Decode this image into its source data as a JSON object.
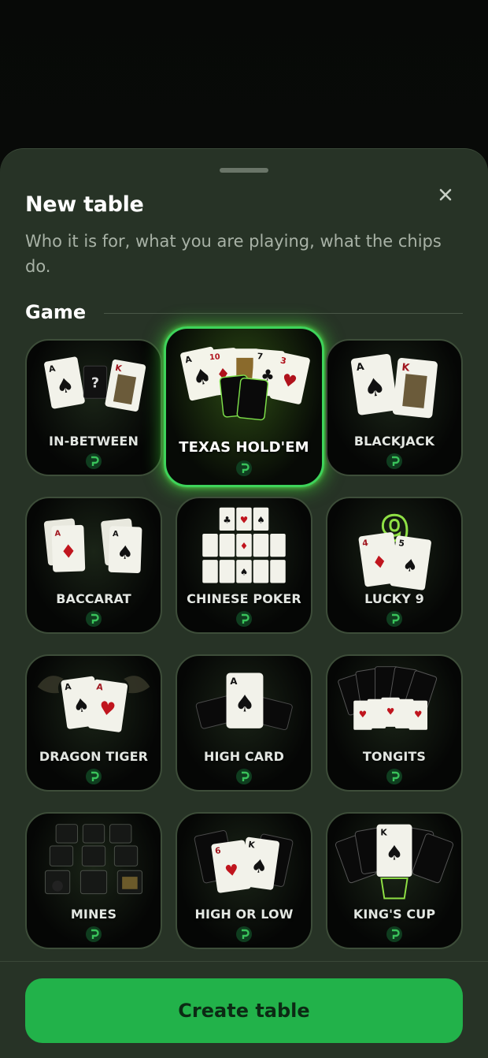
{
  "sheet": {
    "title": "New table",
    "subtitle": "Who it is for, what you are playing, what the chips do.",
    "close_icon": "close-icon",
    "section_label": "Game"
  },
  "games": [
    {
      "label": "IN-BETWEEN",
      "selected": false
    },
    {
      "label": "TEXAS HOLD'EM",
      "selected": true
    },
    {
      "label": "BLACKJACK",
      "selected": false
    },
    {
      "label": "BACCARAT",
      "selected": false
    },
    {
      "label": "CHINESE POKER",
      "selected": false
    },
    {
      "label": "LUCKY 9",
      "selected": false
    },
    {
      "label": "DRAGON TIGER",
      "selected": false
    },
    {
      "label": "HIGH CARD",
      "selected": false
    },
    {
      "label": "TONGITS",
      "selected": false
    },
    {
      "label": "MINES",
      "selected": false
    },
    {
      "label": "HIGH OR LOW",
      "selected": false
    },
    {
      "label": "KING'S CUP",
      "selected": false
    }
  ],
  "footer": {
    "create_label": "Create table"
  },
  "colors": {
    "accent": "#22b24a",
    "selected_glow": "#3ed35a",
    "sheet_bg": "#273326"
  }
}
